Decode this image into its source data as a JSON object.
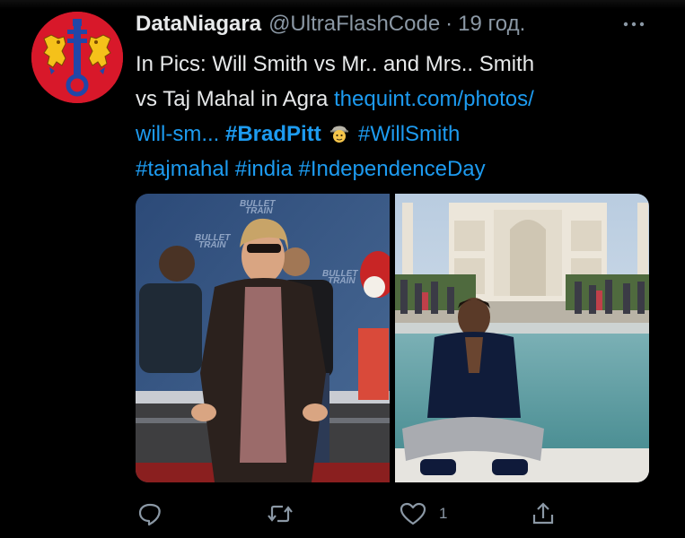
{
  "tweet": {
    "author": {
      "display_name": "DataNiagara",
      "handle": "@UltraFlashCode",
      "separator": "·",
      "timestamp": "19 год.",
      "avatar": "coat-of-arms-icon"
    },
    "more_icon": "more-icon",
    "text": {
      "line1": "In Pics: Will Smith vs Mr.. and Mrs.. Smith",
      "line2_plain": "vs Taj Mahal in Agra ",
      "link_part1": "thequint.com/photos/",
      "link_part2": "will-sm...",
      "hashtag_bradpitt": "#BradPitt",
      "emoji": "detective-emoji",
      "hashtag_willsmith": "#WillSmith",
      "hashtag_tajmahal": "#tajmahal",
      "hashtag_india": "#india",
      "hashtag_independence": "#IndependenceDay"
    },
    "media": [
      {
        "description_icon": "premiere-photo"
      },
      {
        "description_icon": "taj-mahal-photo"
      }
    ],
    "photo_texts": {
      "banner1": "BULLET",
      "banner2": "TRAIN"
    },
    "actions": {
      "reply_icon": "reply-icon",
      "retweet_icon": "retweet-icon",
      "like_icon": "heart-icon",
      "like_count": "1",
      "share_icon": "share-icon"
    },
    "colors": {
      "accent": "#1d9bf0",
      "text": "#e7e9ea",
      "muted": "#8b98a5",
      "background": "#000000",
      "avatar_red": "#d8182a"
    }
  }
}
